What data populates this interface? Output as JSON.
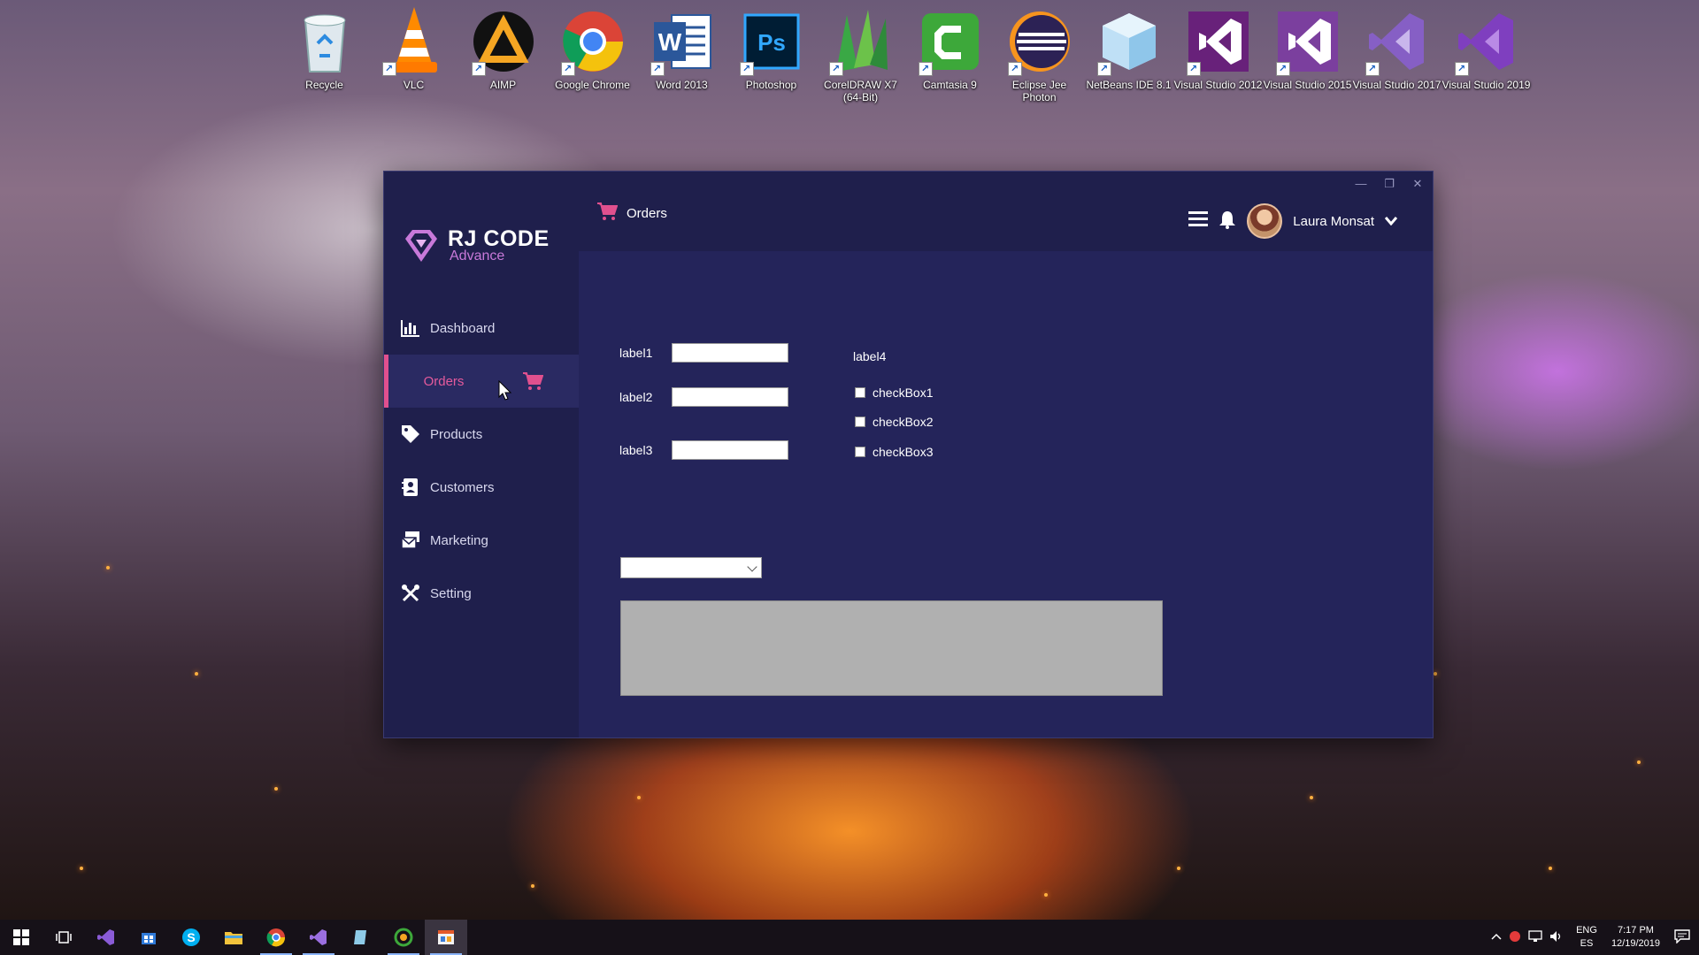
{
  "desktop": {
    "icons": [
      {
        "label": "Recycle",
        "icon": "recycle-bin-icon"
      },
      {
        "label": "VLC",
        "icon": "vlc-cone-icon"
      },
      {
        "label": "AIMP",
        "icon": "aimp-icon"
      },
      {
        "label": "Google Chrome",
        "icon": "chrome-icon"
      },
      {
        "label": "Word 2013",
        "icon": "word-icon"
      },
      {
        "label": "Photoshop",
        "icon": "photoshop-icon"
      },
      {
        "label": "CorelDRAW X7 (64-Bit)",
        "icon": "coreldraw-icon"
      },
      {
        "label": "Camtasia 9",
        "icon": "camtasia-icon"
      },
      {
        "label": "Eclipse Jee Photon",
        "icon": "eclipse-icon"
      },
      {
        "label": "NetBeans IDE 8.1",
        "icon": "netbeans-icon"
      },
      {
        "label": "Visual Studio 2012",
        "icon": "visual-studio-icon"
      },
      {
        "label": "Visual Studio 2015",
        "icon": "visual-studio-icon"
      },
      {
        "label": "Visual Studio 2017",
        "icon": "visual-studio-icon"
      },
      {
        "label": "Visual Studio 2019",
        "icon": "visual-studio-icon"
      }
    ]
  },
  "app": {
    "brand": "RJ CODE",
    "brand_sub": "Advance",
    "menu": [
      {
        "label": "Dashboard",
        "icon": "bar-chart-icon"
      },
      {
        "label": "Orders",
        "icon": "cart-icon"
      },
      {
        "label": "Products",
        "icon": "tag-icon"
      },
      {
        "label": "Customers",
        "icon": "contact-card-icon"
      },
      {
        "label": "Marketing",
        "icon": "mail-stack-icon"
      },
      {
        "label": "Setting",
        "icon": "tools-icon"
      }
    ],
    "breadcrumb": "Orders",
    "user_name": "Laura Monsat",
    "form": {
      "label1": "label1",
      "label2": "label2",
      "label3": "label3",
      "label4": "label4",
      "textbox1": "",
      "textbox2": "",
      "textbox3": "",
      "checkBox1": "checkBox1",
      "checkBox2": "checkBox2",
      "checkBox3": "checkBox3",
      "combo_value": ""
    },
    "colors": {
      "sidebar": "#1f1f4c",
      "content": "#24245a",
      "accent": "#e0508e"
    }
  },
  "taskbar": {
    "lang_top": "ENG",
    "lang_bottom": "ES",
    "time": "7:17 PM",
    "date": "12/19/2019"
  }
}
